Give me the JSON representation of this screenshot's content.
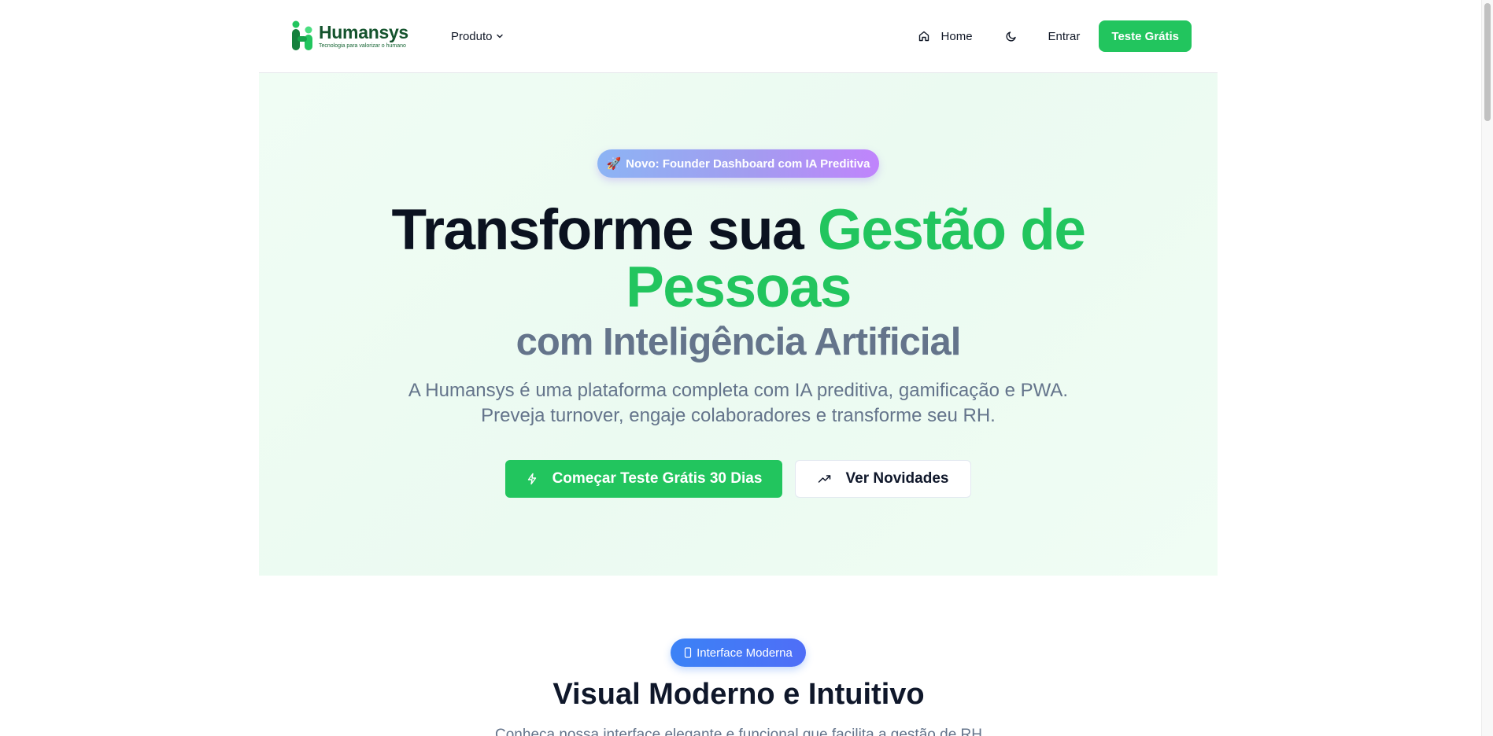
{
  "brand": {
    "name": "Humansys",
    "tagline": "Tecnologia para valorizar o humano",
    "primary_color": "#22c55e"
  },
  "nav": {
    "produto_label": "Produto",
    "home_label": "Home",
    "entrar_label": "Entrar",
    "trial_label": "Teste Grátis"
  },
  "hero": {
    "badge_emoji": "🚀",
    "badge_text": "Novo: Founder Dashboard com IA Preditiva",
    "title_dark": "Transforme sua ",
    "title_green_1": "Gestão de",
    "title_green_2": "Pessoas",
    "subtitle": "com Inteligência Artificial",
    "desc_line1": "A Humansys é uma plataforma completa com IA preditiva, gamificação e PWA.",
    "desc_line2": "Preveja turnover, engaje colaboradores e transforme seu RH.",
    "cta_primary": "Começar Teste Grátis 30 Dias",
    "cta_secondary": "Ver Novidades"
  },
  "section2": {
    "badge_text": "Interface Moderna",
    "title": "Visual Moderno e Intuitivo",
    "desc": "Conheça nossa interface elegante e funcional que facilita a gestão de RH"
  }
}
